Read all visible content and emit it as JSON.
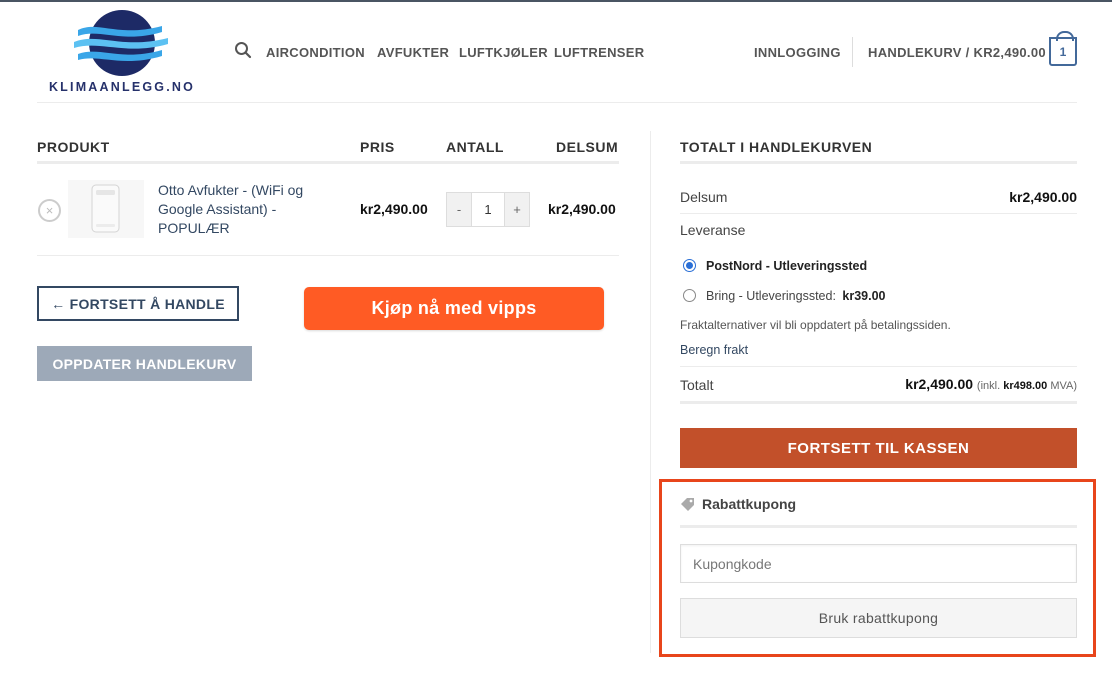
{
  "brand": {
    "name": "KLIMAANLEGG.NO",
    "primary": "#334862",
    "accent": "#c2502a",
    "vipps": "#ff5b24",
    "highlight": "#e8451b"
  },
  "header": {
    "search_icon": "search-icon",
    "nav": [
      "AIRCONDITION",
      "AVFUKTER",
      "LUFTKJØLER",
      "LUFTRENSER"
    ],
    "login": "INNLOGGING",
    "cart_label": "HANDLEKURV / KR2,490.00",
    "cart_count": "1",
    "cart_icon": "shopping-bag-icon"
  },
  "cart": {
    "headers": {
      "product": "PRODUKT",
      "price": "PRIS",
      "quantity": "ANTALL",
      "subtotal": "DELSUM"
    },
    "items": [
      {
        "remove": "×",
        "name": "Otto Avfukter - (WiFi og Google Assistant) - POPULÆR",
        "price": "kr2,490.00",
        "quantity": "1",
        "minus": "-",
        "plus": "+",
        "subtotal": "kr2,490.00"
      }
    ],
    "continue_label": "← FORTSETT Å HANDLE",
    "vipps_label": "Kjøp nå med vipps",
    "update_label": "OPPDATER HANDLEKURV"
  },
  "totals": {
    "title": "TOTALT I HANDLEKURVEN",
    "subtotal_label": "Delsum",
    "subtotal_value": "kr2,490.00",
    "shipping_label": "Leveranse",
    "shipping_options": [
      {
        "label": "PostNord - Utleveringssted",
        "price": "",
        "selected": true
      },
      {
        "label": "Bring - Utleveringssted:",
        "price": "kr39.00",
        "selected": false
      }
    ],
    "shipping_note": "Fraktalternativer vil bli oppdatert på betalingssiden.",
    "calc_shipping": "Beregn frakt",
    "total_label": "Totalt",
    "total_value": "kr2,490.00",
    "tax_prefix": "(inkl.",
    "tax_value": "kr498.00",
    "tax_suffix": "MVA)",
    "checkout_label": "FORTSETT TIL KASSEN"
  },
  "coupon": {
    "title": "Rabattkupong",
    "icon": "tag-icon",
    "placeholder": "Kupongkode",
    "apply_label": "Bruk rabattkupong"
  }
}
